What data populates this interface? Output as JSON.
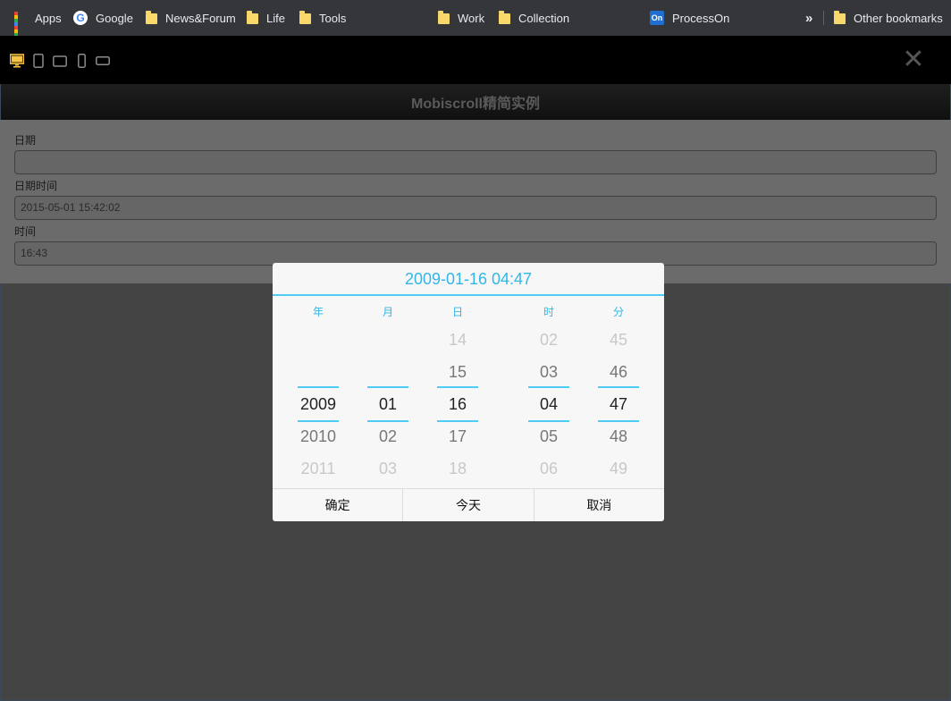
{
  "bookmarks": {
    "items": [
      {
        "label": "Apps",
        "icon": "apps-icon"
      },
      {
        "label": "Google",
        "icon": "google-icon"
      },
      {
        "label": "News&Forum",
        "icon": "folder-icon"
      },
      {
        "label": "Life",
        "icon": "folder-icon"
      },
      {
        "label": "Tools",
        "icon": "folder-icon"
      },
      {
        "label": "Work",
        "icon": "folder-icon"
      },
      {
        "label": "Collection",
        "icon": "folder-icon"
      },
      {
        "label": "ProcessOn",
        "icon": "processon-icon"
      }
    ],
    "more_label": "»",
    "other_label": "Other bookmarks",
    "google_glyph": "G",
    "processon_glyph": "On"
  },
  "devicebar": {
    "devices": [
      "desktop-icon",
      "tablet-portrait-icon",
      "tablet-landscape-icon",
      "phone-portrait-icon",
      "phone-landscape-icon"
    ],
    "active_color": "#f6c445",
    "close_glyph": "✕"
  },
  "app": {
    "title": "Mobiscroll精简实例",
    "fields": [
      {
        "label": "日期",
        "value": ""
      },
      {
        "label": "日期时间",
        "value": "2015-05-01 15:42:02"
      },
      {
        "label": "时间",
        "value": "16:43"
      }
    ]
  },
  "picker": {
    "header": "2009-01-16 04:47",
    "accent": "#31b6e7",
    "columns": [
      {
        "label": "年",
        "values": [
          "",
          "",
          "2009",
          "2010",
          "2011"
        ]
      },
      {
        "label": "月",
        "values": [
          "",
          "",
          "01",
          "02",
          "03"
        ]
      },
      {
        "label": "日",
        "values": [
          "14",
          "15",
          "16",
          "17",
          "18"
        ]
      },
      {
        "label": "时",
        "values": [
          "02",
          "03",
          "04",
          "05",
          "06"
        ]
      },
      {
        "label": "分",
        "values": [
          "45",
          "46",
          "47",
          "48",
          "49"
        ]
      }
    ],
    "buttons": {
      "confirm": "确定",
      "today": "今天",
      "cancel": "取消"
    }
  }
}
